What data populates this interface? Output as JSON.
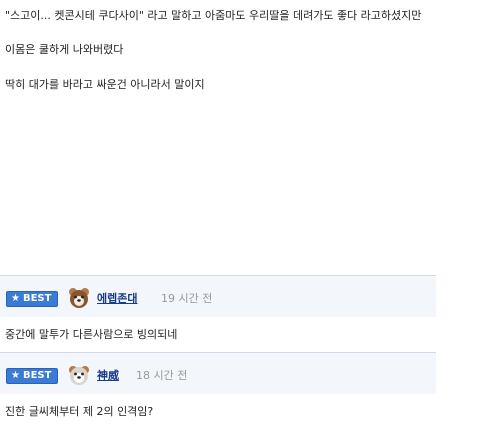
{
  "post": {
    "lines": [
      "\"스고이... 켓콘시테 쿠다사이\" 라고 말하고 아줌마도 우리딸을 데려가도 좋다 라고하셨지만",
      "이몸은 쿨하게 나와버렸다",
      "딱히 대가를 바라고 싸운건 아니라서 말이지"
    ]
  },
  "comments": [
    {
      "badge": "BEST",
      "badge_icon": "star-icon",
      "nickname": "에렙존대",
      "time": "19 시간 전",
      "text": "중간에 말투가 다른사람으로 빙의되네"
    },
    {
      "badge": "BEST",
      "badge_icon": "star-icon",
      "nickname": "神威",
      "time": "18 시간 전",
      "text": "진한 글씨체부터 제 2의 인격임?"
    }
  ],
  "colors": {
    "badge_bg": "#3a7bd5",
    "comment_header_bg": "#f3f6fa",
    "nickname": "#1a3b8a",
    "time": "#999999",
    "separator": "#cfdbe8"
  }
}
